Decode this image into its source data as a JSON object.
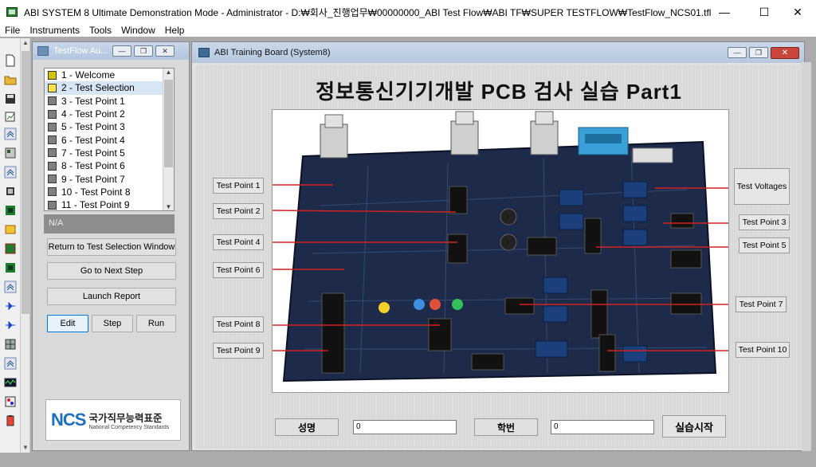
{
  "window": {
    "title": "ABI SYSTEM 8 Ultimate Demonstration Mode - Administrator - D:₩회사_진행업무₩00000000_ABI Test Flow₩ABI TF₩SUPER TESTFLOW₩TestFlow_NCS01.tfl",
    "minimize": "—",
    "maximize": "☐",
    "close": "✕"
  },
  "menu": [
    "File",
    "Instruments",
    "Tools",
    "Window",
    "Help"
  ],
  "toolbar_icons": [
    "new-file-icon",
    "open-folder-icon",
    "save-icon",
    "edit-chart-icon",
    "collapse-up-icon",
    "instrument-icon",
    "collapse-up-icon",
    "chip-icon",
    "chip-green-icon",
    "folder-yellow-icon",
    "board-icon",
    "chip-green-icon",
    "collapse-up-icon",
    "diode-icon",
    "diode-icon",
    "grid-icon",
    "collapse-up-icon",
    "oscilloscope-icon",
    "analyzer-icon",
    "battery-icon"
  ],
  "testflow": {
    "title": "TestFlow Au...",
    "steps": [
      "1 - Welcome",
      "2 - Test Selection",
      "3 - Test Point 1",
      "4 - Test Point 2",
      "5 - Test Point 3",
      "6 - Test Point 4",
      "7 - Test Point 5",
      "8 - Test Point 6",
      "9 - Test Point 7",
      "10 - Test Point 8",
      "11 - Test Point 9"
    ],
    "selected_index": 1,
    "status": "N/A",
    "return_button": "Return to Test Selection Window",
    "next_button": "Go to Next Step",
    "report_button": "Launch Report",
    "edit_button": "Edit",
    "step_button": "Step",
    "run_button": "Run",
    "ncs_logo": "NCS",
    "ncs_kr": "국가직무능력표준",
    "ncs_en": "National Competency Standards"
  },
  "board": {
    "title": "ABI Training Board (System8)",
    "heading": "정보통신기기개발 PCB 검사 실습 Part1",
    "left_points": [
      "Test Point 1",
      "Test Point 2",
      "Test Point 4",
      "Test Point 6",
      "Test Point 8",
      "Test Point 9"
    ],
    "right_points": [
      "Test Voltages",
      "Test Point 3",
      "Test Point 5",
      "Test Point 7",
      "Test Point 10"
    ],
    "name_label": "성명",
    "name_value": "0",
    "id_label": "학번",
    "id_value": "0",
    "start_button": "실습시작"
  },
  "colors": {
    "pcb": "#1d2a4a",
    "leader": "#d22020",
    "connector": "#3aa0d8"
  }
}
